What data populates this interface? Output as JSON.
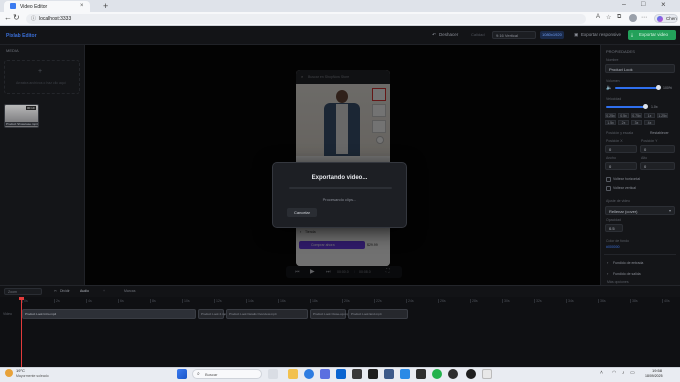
{
  "browser": {
    "tab_title": "Video Editor",
    "url": "localhost:3333",
    "profile_label": "Chen"
  },
  "appbar": {
    "brand": "Pixlab Editor",
    "undo_label": "Deshacer",
    "quality_label": "Calidad",
    "resolution": "9:16 Vertical",
    "resolution_badge": "1080x1920",
    "export_options": "Exportar responsive",
    "export_button": "Exportar video"
  },
  "left_panel": {
    "title": "MEDIA",
    "drop_hint": "Arrastra archivos o haz clic aquí",
    "thumb_duration": "00:10",
    "thumb_label": "Product Showcase.mp4"
  },
  "phone": {
    "search_placeholder": "Buscar en ShopNow Store",
    "cta_label": "Comprar ahora",
    "price": "$29.99",
    "shop_label": "Tienda"
  },
  "player": {
    "time": "00:00.0",
    "duration": "00:08.0"
  },
  "right_panel": {
    "title": "PROPIEDADES",
    "name_label": "Nombre",
    "name_value": "Product Look",
    "volume_label": "Volumen",
    "volume_value": "100%",
    "speed_label": "Velocidad",
    "speed_value": "1.0x",
    "speed_presets": [
      "0.25x",
      "0.5x",
      "0.75x",
      "1x",
      "1.25x",
      "1.5x",
      "2x",
      "3x",
      "4x"
    ],
    "transform_label": "Posición y escala",
    "reset_label": "Restablecer",
    "x_label": "Posición X",
    "x_value": "0",
    "y_label": "Posición Y",
    "y_value": "0",
    "w_label": "Ancho",
    "w_value": "0",
    "h_label": "Alto",
    "h_value": "0",
    "rotate_label": "Rotación",
    "rotate_value": "0",
    "flip_h_label": "Voltear horizontal",
    "flip_v_label": "Voltear vertical",
    "fit_label": "Ajuste de video",
    "fit_value": "Rellenar (cover)",
    "opacity_label": "Opacidad",
    "opacity_value": "0.5",
    "color_label": "Color de fondo",
    "color_value": "#000000",
    "fade_in_label": "Fundido de entrada",
    "fade_out_label": "Fundido de salida",
    "more_label": "Más opciones"
  },
  "timeline": {
    "zoom": "Zoom",
    "split_label": "Dividir",
    "audio_label": "Audio",
    "marks_label": "Marcas",
    "track_label": "Video",
    "ticks": [
      "0s",
      "2s",
      "4s",
      "6s",
      "8s",
      "10s",
      "12s",
      "14s",
      "16s",
      "18s",
      "20s",
      "22s",
      "24s",
      "26s",
      "28s",
      "30s",
      "32s",
      "34s",
      "36s",
      "38s",
      "40s"
    ],
    "clips": [
      {
        "label": "Product Look Intro.mp4"
      },
      {
        "label": "Product Look 2.mp4"
      },
      {
        "label": "Product Look Details Overview.mp4"
      },
      {
        "label": "Product Look Close-up.mp4"
      },
      {
        "label": "Product Look End.mp4"
      }
    ]
  },
  "modal": {
    "title": "Exportando video...",
    "status": "Procesando clips...",
    "progress": 0,
    "cancel_label": "Cancelar"
  },
  "taskbar": {
    "weather_temp": "19°C",
    "weather_desc": "Mayormente soleado",
    "search_placeholder": "Buscar",
    "time": "19:58",
    "date": "18/09/2025"
  },
  "colors": {
    "accent": "#2f6fed",
    "export_green": "#23a15a",
    "playhead": "#e23b3b",
    "cta_purple": "#6a3de8"
  }
}
